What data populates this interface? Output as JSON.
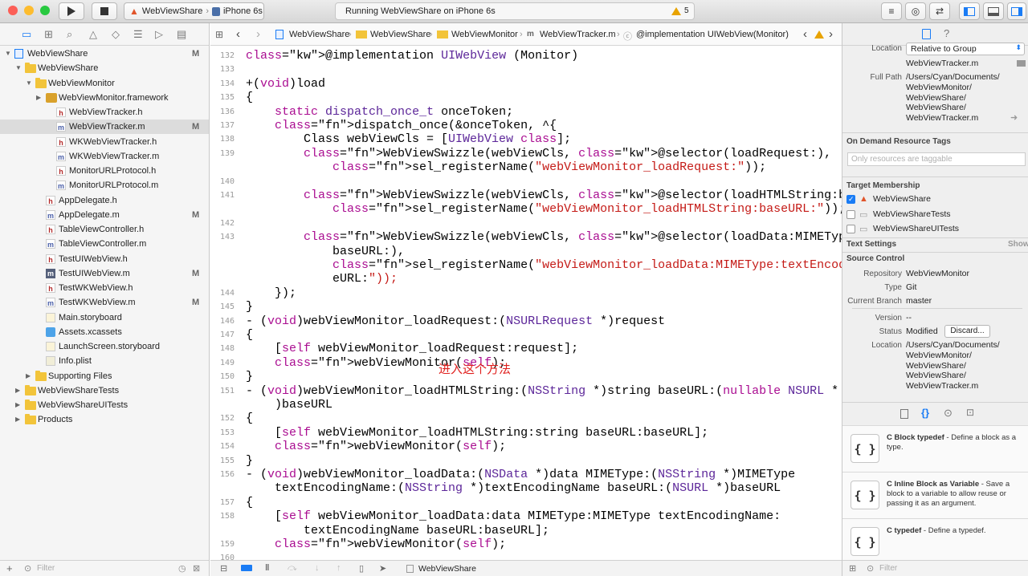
{
  "toolbar": {
    "scheme_target": "WebViewShare",
    "device": "iPhone 6s",
    "activity_text": "Running WebViewShare on iPhone 6s",
    "warning_count": "5"
  },
  "navigator": {
    "filter_placeholder": "Filter",
    "rows": [
      {
        "label": "WebViewShare",
        "status": "M"
      },
      {
        "label": "WebViewShare",
        "status": ""
      },
      {
        "label": "WebViewMonitor",
        "status": ""
      },
      {
        "label": "WebViewMonitor.framework",
        "status": ""
      },
      {
        "label": "WebViewTracker.h",
        "status": ""
      },
      {
        "label": "WebViewTracker.m",
        "status": "M"
      },
      {
        "label": "WKWebViewTracker.h",
        "status": ""
      },
      {
        "label": "WKWebViewTracker.m",
        "status": ""
      },
      {
        "label": "MonitorURLProtocol.h",
        "status": ""
      },
      {
        "label": "MonitorURLProtocol.m",
        "status": ""
      },
      {
        "label": "AppDelegate.h",
        "status": ""
      },
      {
        "label": "AppDelegate.m",
        "status": "M"
      },
      {
        "label": "TableViewController.h",
        "status": ""
      },
      {
        "label": "TableViewController.m",
        "status": ""
      },
      {
        "label": "TestUIWebView.h",
        "status": ""
      },
      {
        "label": "TestUIWebView.m",
        "status": "M"
      },
      {
        "label": "TestWKWebView.h",
        "status": ""
      },
      {
        "label": "TestWKWebView.m",
        "status": "M"
      },
      {
        "label": "Main.storyboard",
        "status": ""
      },
      {
        "label": "Assets.xcassets",
        "status": ""
      },
      {
        "label": "LaunchScreen.storyboard",
        "status": ""
      },
      {
        "label": "Info.plist",
        "status": ""
      },
      {
        "label": "Supporting Files",
        "status": ""
      },
      {
        "label": "WebViewShareTests",
        "status": ""
      },
      {
        "label": "WebViewShareUITests",
        "status": ""
      },
      {
        "label": "Products",
        "status": ""
      }
    ]
  },
  "jumpbar": {
    "crumbs": [
      "WebViewShare",
      "WebViewShare",
      "WebViewMonitor",
      "WebViewTracker.m",
      "@implementation UIWebView(Monitor)"
    ]
  },
  "editor": {
    "line_numbers": [
      "132",
      "133",
      "134",
      "135",
      "136",
      "137",
      "138",
      "139",
      "140",
      "141",
      "142",
      "143",
      "144",
      "145",
      "146",
      "147",
      "148",
      "149",
      "150",
      "151",
      "152",
      "153",
      "154",
      "155",
      "156",
      "157",
      "158",
      "159",
      "160"
    ],
    "lines": [
      "@implementation UIWebView (Monitor)",
      "",
      "+(void)load",
      "{",
      "    static dispatch_once_t onceToken;",
      "    dispatch_once(&onceToken, ^{",
      "        Class webViewCls = [UIWebView class];",
      "        WebViewSwizzle(webViewCls, @selector(loadRequest:),",
      "            sel_registerName(\"webViewMonitor_loadRequest:\"));",
      "",
      "        WebViewSwizzle(webViewCls, @selector(loadHTMLString:baseURL:),",
      "            sel_registerName(\"webViewMonitor_loadHTMLString:baseURL:\"));",
      "",
      "        WebViewSwizzle(webViewCls, @selector(loadData:MIMEType:textEncodingName:",
      "            baseURL:),",
      "            sel_registerName(\"webViewMonitor_loadData:MIMEType:textEncodingName:bas",
      "            eURL:\"));",
      "    });",
      "}",
      "- (void)webViewMonitor_loadRequest:(NSURLRequest *)request",
      "{",
      "    [self webViewMonitor_loadRequest:request];",
      "    webViewMonitor(self);",
      "}",
      "- (void)webViewMonitor_loadHTMLString:(NSString *)string baseURL:(nullable NSURL *",
      "    )baseURL",
      "{",
      "    [self webViewMonitor_loadHTMLString:string baseURL:baseURL];",
      "    webViewMonitor(self);",
      "}",
      "- (void)webViewMonitor_loadData:(NSData *)data MIMEType:(NSString *)MIMEType",
      "    textEncodingName:(NSString *)textEncodingName baseURL:(NSURL *)baseURL",
      "{",
      "    [self webViewMonitor_loadData:data MIMEType:MIMEType textEncodingName:",
      "        textEncodingName baseURL:baseURL];",
      "    webViewMonitor(self);"
    ],
    "annotation": "进入这个方法",
    "debug_target": "WebViewShare"
  },
  "inspector": {
    "location_label": "Location",
    "location_value": "Relative to Group",
    "file_name": "WebViewTracker.m",
    "full_path_label": "Full Path",
    "full_path_lines": [
      "/Users/Cyan/Documents/",
      "WebViewMonitor/",
      "WebViewShare/",
      "WebViewShare/",
      "WebViewTracker.m"
    ],
    "odr_title": "On Demand Resource Tags",
    "odr_placeholder": "Only resources are taggable",
    "target_title": "Target Membership",
    "targets": [
      {
        "name": "WebViewShare",
        "checked": true
      },
      {
        "name": "WebViewShareTests",
        "checked": false
      },
      {
        "name": "WebViewShareUITests",
        "checked": false
      }
    ],
    "text_settings_title": "Text Settings",
    "text_settings_show": "Show",
    "source_control_title": "Source Control",
    "repository_label": "Repository",
    "repository_value": "WebViewMonitor",
    "type_label": "Type",
    "type_value": "Git",
    "branch_label": "Current Branch",
    "branch_value": "master",
    "version_label": "Version",
    "version_value": "--",
    "status_label": "Status",
    "status_value": "Modified",
    "discard_label": "Discard...",
    "sc_location_label": "Location",
    "sc_path_lines": [
      "/Users/Cyan/Documents/",
      "WebViewMonitor/",
      "WebViewShare/",
      "WebViewShare/",
      "WebViewTracker.m"
    ],
    "library": [
      {
        "icon": "{ }",
        "title": "C Block typedef",
        "desc": " - Define a block as a type."
      },
      {
        "icon": "{ }",
        "title": "C Inline Block as Variable",
        "desc": " - Save a block to a variable to allow reuse or passing it as an argument."
      },
      {
        "icon": "{ }",
        "title": "C typedef",
        "desc": " - Define a typedef."
      }
    ],
    "filter_placeholder": "Filter"
  },
  "colors": {
    "accent": "#1a7cf5",
    "keyword": "#aa0d91",
    "string": "#c41a16",
    "class": "#5c2699",
    "warning": "#e8a300"
  }
}
